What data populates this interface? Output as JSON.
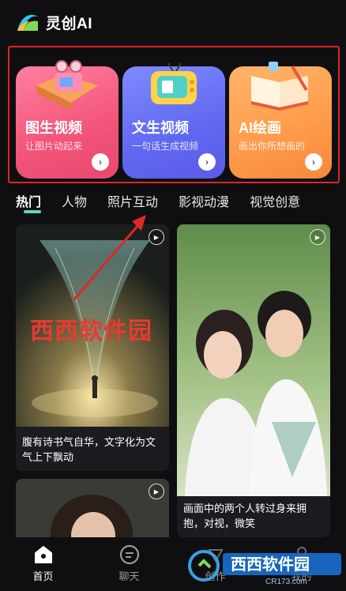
{
  "header": {
    "title": "灵创AI",
    "logo_icon": "lingchuang-logo-icon"
  },
  "features": [
    {
      "title": "图生视频",
      "subtitle": "让图片动起来",
      "icon": "film-reel-icon"
    },
    {
      "title": "文生视频",
      "subtitle": "一句话生成视频",
      "icon": "tv-icon"
    },
    {
      "title": "AI绘画",
      "subtitle": "画出你所想画的",
      "icon": "book-icon"
    }
  ],
  "tabs": [
    "热门",
    "人物",
    "照片互动",
    "影视动漫",
    "视觉创意"
  ],
  "active_tab": "热门",
  "feed": [
    {
      "caption": "腹有诗书气自华，文字化为文气上下飘动"
    },
    {
      "caption": "画面中的两个人转过身来拥抱，对视，微笑"
    }
  ],
  "overlay": {
    "watermark_text": "西西软件园",
    "brand_text": "西西软件园",
    "brand_url": "CR173.com"
  },
  "nav": [
    {
      "label": "首页",
      "icon": "home-icon"
    },
    {
      "label": "聊天",
      "icon": "chat-icon"
    },
    {
      "label": "创作",
      "icon": "create-icon"
    },
    {
      "label": "我的",
      "icon": "profile-icon"
    }
  ],
  "colors": {
    "accent": "#5fd6c1",
    "highlight_border": "#e02424",
    "card1": "#f25579",
    "card2": "#6168f0",
    "card3": "#ff9a4a"
  }
}
